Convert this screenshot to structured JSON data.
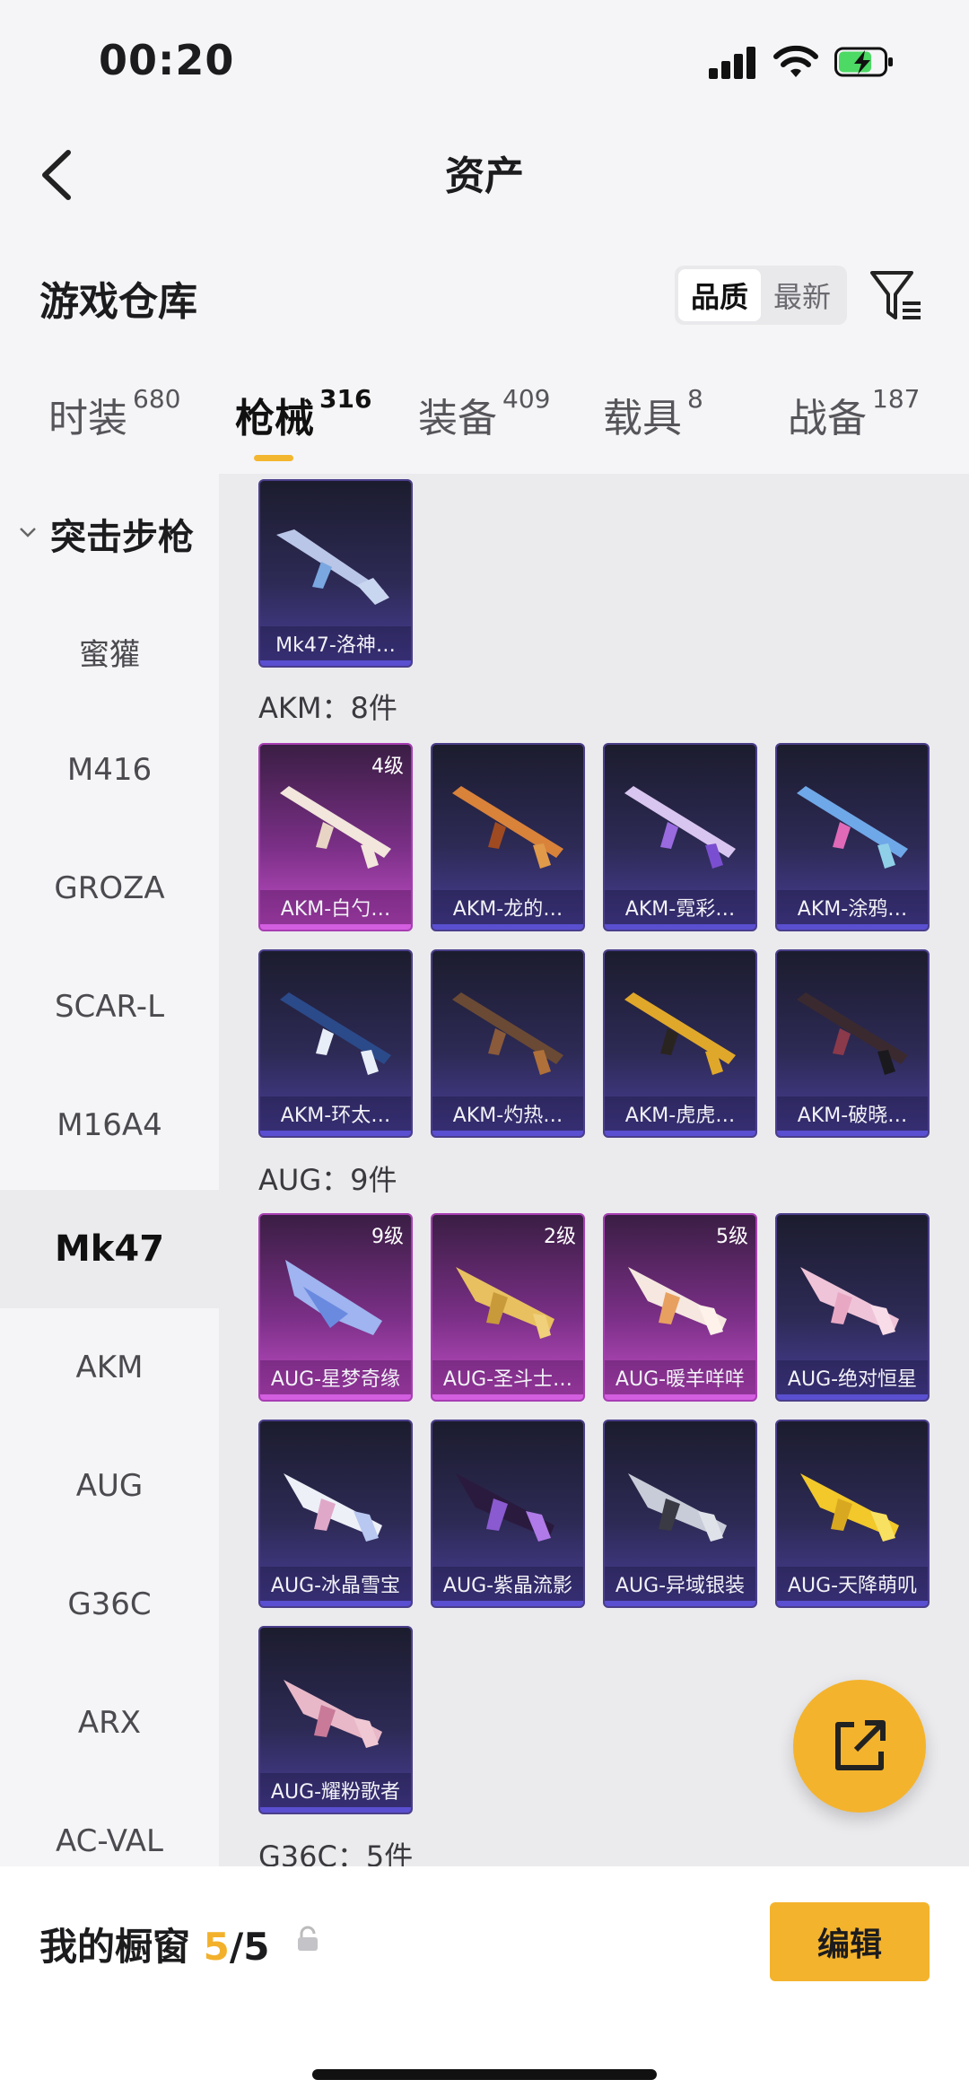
{
  "status": {
    "time": "00:20"
  },
  "header": {
    "title": "资产"
  },
  "warehouse": {
    "title": "游戏仓库",
    "sort_quality": "品质",
    "sort_newest": "最新"
  },
  "tabs": [
    {
      "label": "时装",
      "count": "680"
    },
    {
      "label": "枪械",
      "count": "316"
    },
    {
      "label": "装备",
      "count": "409"
    },
    {
      "label": "载具",
      "count": "8"
    },
    {
      "label": "战备",
      "count": "187"
    }
  ],
  "sidebar": {
    "category": "突击步枪",
    "items": [
      "蜜獾",
      "M416",
      "GROZA",
      "SCAR-L",
      "M16A4",
      "Mk47",
      "AKM",
      "AUG",
      "G36C",
      "ARX",
      "AC-VAL"
    ]
  },
  "sections": {
    "mk47": {
      "cards": [
        {
          "name": "Mk47-洛神…"
        }
      ]
    },
    "akm": {
      "heading": "AKM：8件",
      "cards": [
        {
          "name": "AKM-白勺…",
          "level": "4级"
        },
        {
          "name": "AKM-龙的…"
        },
        {
          "name": "AKM-霓彩…"
        },
        {
          "name": "AKM-涂鸦…"
        },
        {
          "name": "AKM-环太…"
        },
        {
          "name": "AKM-灼热…"
        },
        {
          "name": "AKM-虎虎…"
        },
        {
          "name": "AKM-破晓…"
        }
      ]
    },
    "aug": {
      "heading": "AUG：9件",
      "cards": [
        {
          "name": "AUG-星梦奇缘",
          "level": "9级"
        },
        {
          "name": "AUG-圣斗士…",
          "level": "2级"
        },
        {
          "name": "AUG-暖羊咩咩",
          "level": "5级"
        },
        {
          "name": "AUG-绝对恒星"
        },
        {
          "name": "AUG-冰晶雪宝"
        },
        {
          "name": "AUG-紫晶流影"
        },
        {
          "name": "AUG-异域银装"
        },
        {
          "name": "AUG-天降萌叽"
        },
        {
          "name": "AUG-耀粉歌者"
        }
      ]
    },
    "g36c": {
      "heading": "G36C：5件"
    }
  },
  "bottom": {
    "window_label": "我的橱窗",
    "count_current": "5",
    "count_total": "/5",
    "edit_label": "编辑"
  },
  "icons": [
    "back-icon",
    "filter-icon",
    "share-icon",
    "lock-icon",
    "chevron-down-icon"
  ],
  "colors": {
    "accent": "#f4b32d",
    "rare_purple": "#4a3f9a",
    "epic_pink": "#c24fc8"
  }
}
